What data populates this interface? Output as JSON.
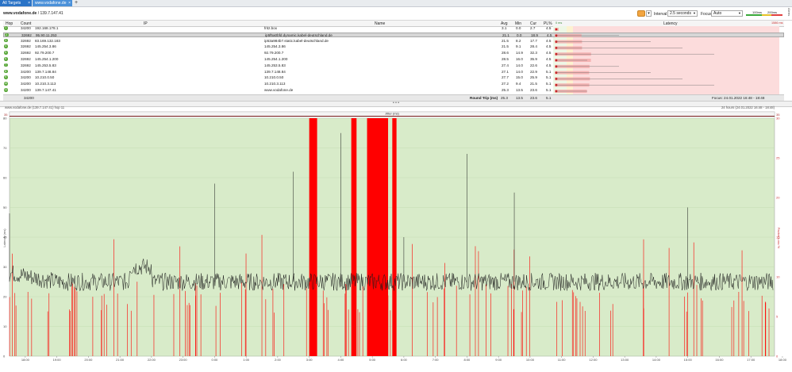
{
  "tabs": [
    {
      "label": "All Targets",
      "close": "×"
    },
    {
      "label": "www.vodafone.de",
      "close": "×"
    }
  ],
  "add_tab": "+",
  "toolbar": {
    "target_name": "www.vodafone.de",
    "target_ip": " / 139.7.147.41",
    "interval_label": "Interval",
    "interval_value": "2.5 seconds",
    "focus_label": "Focus",
    "focus_value": "Auto",
    "scale_left": "100ms",
    "scale_right": "200ms",
    "side_tab": "Alerts"
  },
  "table": {
    "headers": {
      "hop": "Hop",
      "count": "Count",
      "ip": "IP",
      "name": "Name",
      "avg": "Avg",
      "min": "Min",
      "cur": "Cur",
      "pl": "PL%",
      "latency": "Latency"
    },
    "latency_scale_min": "0 ms",
    "latency_scale_max": "1586 ms",
    "rows": [
      {
        "hop": "1",
        "count": "34200",
        "ip": "192.168.178.1",
        "name": "fritz.box",
        "avg": "3.1",
        "min": "0.0",
        "cur": "2.7",
        "pl": "4.5"
      },
      {
        "hop": "2",
        "count": "32692",
        "ip": "95.90.11.253",
        "name": "ip5f5a0bfd.dynamic.kabel-deutschland.de",
        "avg": "21.1",
        "min": "0.0",
        "cur": "18.9",
        "pl": "4.5"
      },
      {
        "hop": "3",
        "count": "32692",
        "ip": "83.169.132.183",
        "name": "ip53a984b7.static.kabel-deutschland.de",
        "avg": "21.5",
        "min": "8.2",
        "cur": "17.7",
        "pl": "4.5"
      },
      {
        "hop": "4",
        "count": "32692",
        "ip": "145.254.3.86",
        "name": "145.254.3.86",
        "avg": "21.5",
        "min": "9.1",
        "cur": "28.4",
        "pl": "4.5"
      },
      {
        "hop": "5",
        "count": "32692",
        "ip": "92.79.200.7",
        "name": "92.79.200.7",
        "avg": "28.6",
        "min": "14.9",
        "cur": "32.3",
        "pl": "4.5"
      },
      {
        "hop": "6",
        "count": "32692",
        "ip": "145.254.1.200",
        "name": "145.254.1.200",
        "avg": "28.5",
        "min": "16.0",
        "cur": "35.9",
        "pl": "4.5"
      },
      {
        "hop": "7",
        "count": "32692",
        "ip": "145.253.5.83",
        "name": "145.253.5.83",
        "avg": "27.4",
        "min": "14.0",
        "cur": "22.6",
        "pl": "4.5"
      },
      {
        "hop": "8",
        "count": "34200",
        "ip": "139.7.148.84",
        "name": "139.7.148.84",
        "avg": "27.1",
        "min": "14.0",
        "cur": "22.9",
        "pl": "5.1"
      },
      {
        "hop": "9",
        "count": "34200",
        "ip": "10.210.0.50",
        "name": "10.210.0.50",
        "avg": "27.7",
        "min": "15.0",
        "cur": "25.9",
        "pl": "5.1"
      },
      {
        "hop": "10",
        "count": "34200",
        "ip": "10.210.3.113",
        "name": "10.210.3.113",
        "avg": "27.2",
        "min": "9.4",
        "cur": "21.5",
        "pl": "5.1"
      },
      {
        "hop": "11",
        "count": "34200",
        "ip": "139.7.147.41",
        "name": "www.vodafone.de",
        "avg": "25.3",
        "min": "13.5",
        "cur": "23.6",
        "pl": "5.1"
      }
    ],
    "summary": {
      "count": "34200",
      "label": "Round Trip (ms)",
      "avg": "25.3",
      "min": "13.5",
      "cur": "23.6",
      "pl": "5.1",
      "focus": "Focus: 24.01.2022 16:48 - 18:48"
    }
  },
  "splitter_glyph": "• • •",
  "chart_caption_left": "www.vodafone.de (139.7.147.41) hop 11",
  "chart_caption_right": "24 hours (24.01.2022 16:48 - 18:48)",
  "colors": {
    "chart_bg": "#d8ebc9",
    "latency_line": "#1a1a1a",
    "loss": "#ff0000",
    "jitter_band": "#7a1f1f"
  },
  "chart_data": {
    "type": "line",
    "title": "Jitter (ms)",
    "ylabel": "Latency (ms)",
    "y2label": "Packet Loss %",
    "y_ticks": [
      "80",
      "70",
      "60",
      "50",
      "40",
      "30",
      "20",
      "10",
      "0"
    ],
    "y2_ticks": [
      "30",
      "25",
      "20",
      "15",
      "10",
      "5",
      "0"
    ],
    "ylim": [
      0,
      80
    ],
    "x_ticks": [
      "18:00",
      "19:00",
      "20:00",
      "21:00",
      "22:00",
      "23:00",
      "0:00",
      "1:00",
      "2:00",
      "3:00",
      "4:00",
      "5:00",
      "6:00",
      "7:00",
      "8:00",
      "9:00",
      "10:00",
      "11:00",
      "12:00",
      "13:00",
      "14:00",
      "15:00",
      "16:00",
      "17:00",
      "18:00"
    ],
    "top_band_labels": {
      "left": "35",
      "right": "35"
    },
    "latency_baseline_ms": 25,
    "latency_spikes": [
      {
        "t": "0:00",
        "ms": 58
      },
      {
        "t": "2:30",
        "ms": 62
      },
      {
        "t": "4:00",
        "ms": 75
      },
      {
        "t": "6:00",
        "ms": 40
      },
      {
        "t": "8:00",
        "ms": 68
      },
      {
        "t": "9:30",
        "ms": 55
      },
      {
        "t": "15:00",
        "ms": 50
      },
      {
        "t": "17:30",
        "ms": 48
      }
    ],
    "total_loss_windows": [
      {
        "start": "3:00",
        "end": "3:15"
      },
      {
        "start": "4:20",
        "end": "4:30"
      },
      {
        "start": "4:50",
        "end": "5:30"
      },
      {
        "start": "5:38",
        "end": "5:46"
      }
    ]
  }
}
